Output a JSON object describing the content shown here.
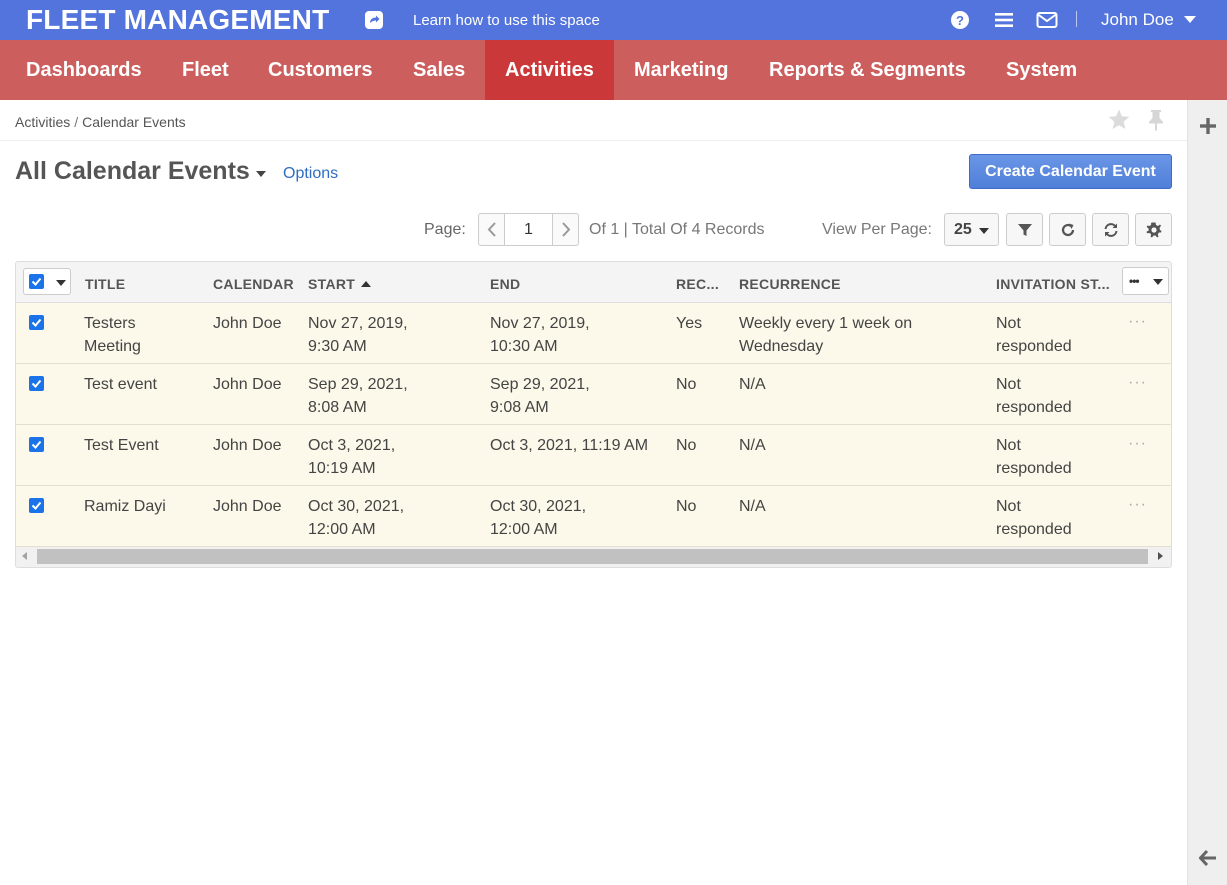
{
  "topbar": {
    "brand": "FLEET MANAGEMENT",
    "learn_link": "Learn how to use this space",
    "user_name": "John Doe",
    "icons": [
      "share-icon",
      "help-icon",
      "menu-icon",
      "mail-icon"
    ]
  },
  "nav": {
    "items": [
      {
        "label": "Dashboards"
      },
      {
        "label": "Fleet"
      },
      {
        "label": "Customers"
      },
      {
        "label": "Sales"
      },
      {
        "label": "Activities",
        "active": true
      },
      {
        "label": "Marketing"
      },
      {
        "label": "Reports & Segments"
      },
      {
        "label": "System"
      }
    ]
  },
  "breadcrumb": {
    "items": [
      "Activities",
      "Calendar Events"
    ],
    "separator": "/"
  },
  "page": {
    "title": "All Calendar Events",
    "options_label": "Options",
    "create_button": "Create Calendar Event"
  },
  "pager": {
    "label": "Page:",
    "current": "1",
    "info": "Of 1 | Total Of 4 Records",
    "view_per_page_label": "View Per Page:",
    "view_per_page_value": "25"
  },
  "grid": {
    "columns": [
      "TITLE",
      "CALENDAR",
      "START",
      "END",
      "REC...",
      "RECURRENCE",
      "INVITATION ST..."
    ],
    "sorted_column": "START",
    "sort_direction": "asc",
    "rows": [
      {
        "title": "Testers Meeting",
        "calendar": "John Doe",
        "start": "Nov 27, 2019, 9:30 AM",
        "end": "Nov 27, 2019, 10:30 AM",
        "recurring": "Yes",
        "recurrence": "Weekly every 1 week on Wednesday",
        "invitation_status": "Not responded",
        "checked": true
      },
      {
        "title": "Test event",
        "calendar": "John Doe",
        "start": "Sep 29, 2021, 8:08 AM",
        "end": "Sep 29, 2021, 9:08 AM",
        "recurring": "No",
        "recurrence": "N/A",
        "invitation_status": "Not responded",
        "checked": true
      },
      {
        "title": "Test Event",
        "calendar": "John Doe",
        "start": "Oct 3, 2021, 10:19 AM",
        "end": "Oct 3, 2021, 11:19 AM",
        "recurring": "No",
        "recurrence": "N/A",
        "invitation_status": "Not responded",
        "checked": true
      },
      {
        "title": "Ramiz Dayi",
        "calendar": "John Doe",
        "start": "Oct 30, 2021, 12:00 AM",
        "end": "Oct 30, 2021, 12:00 AM",
        "recurring": "No",
        "recurrence": "N/A",
        "invitation_status": "Not responded",
        "checked": true
      }
    ],
    "row_action": "···"
  },
  "colors": {
    "topbar": "#5274dc",
    "nav": "#cd5e5e",
    "nav_active": "#cb3839",
    "primary_button": "#5a88de",
    "row_selected": "#fcf8ea",
    "link": "#2d6ec3"
  }
}
